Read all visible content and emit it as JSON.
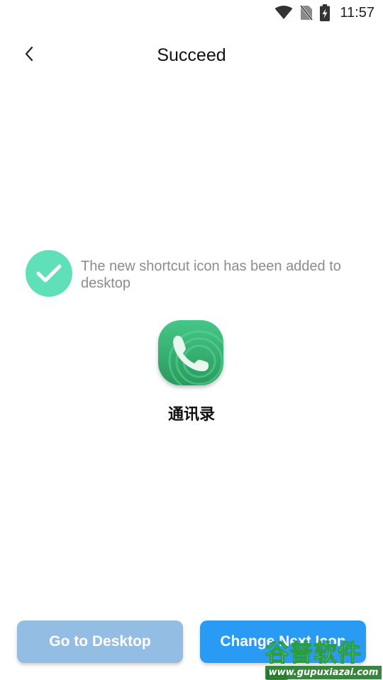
{
  "status_bar": {
    "time": "11:57",
    "icons": [
      "wifi-icon",
      "no-sim-icon",
      "battery-charging-icon"
    ]
  },
  "header": {
    "title": "Succeed",
    "back_icon": "chevron-left-icon"
  },
  "message": {
    "icon": "check-circle-icon",
    "text": "The new shortcut icon has been added to desktop",
    "text_color": "#8c8c8c",
    "icon_color": "#5fe0b8"
  },
  "shortcut": {
    "icon": "phone-icon",
    "name": "通讯录"
  },
  "buttons": {
    "go_to_desktop": "Go to Desktop",
    "change_next_icon": "Change Next Icon",
    "desktop_color": "#93bde3",
    "next_color": "#2a9bf5"
  },
  "watermark": {
    "title": "谷普软件园",
    "url": "www.gupuxiazai.com"
  }
}
